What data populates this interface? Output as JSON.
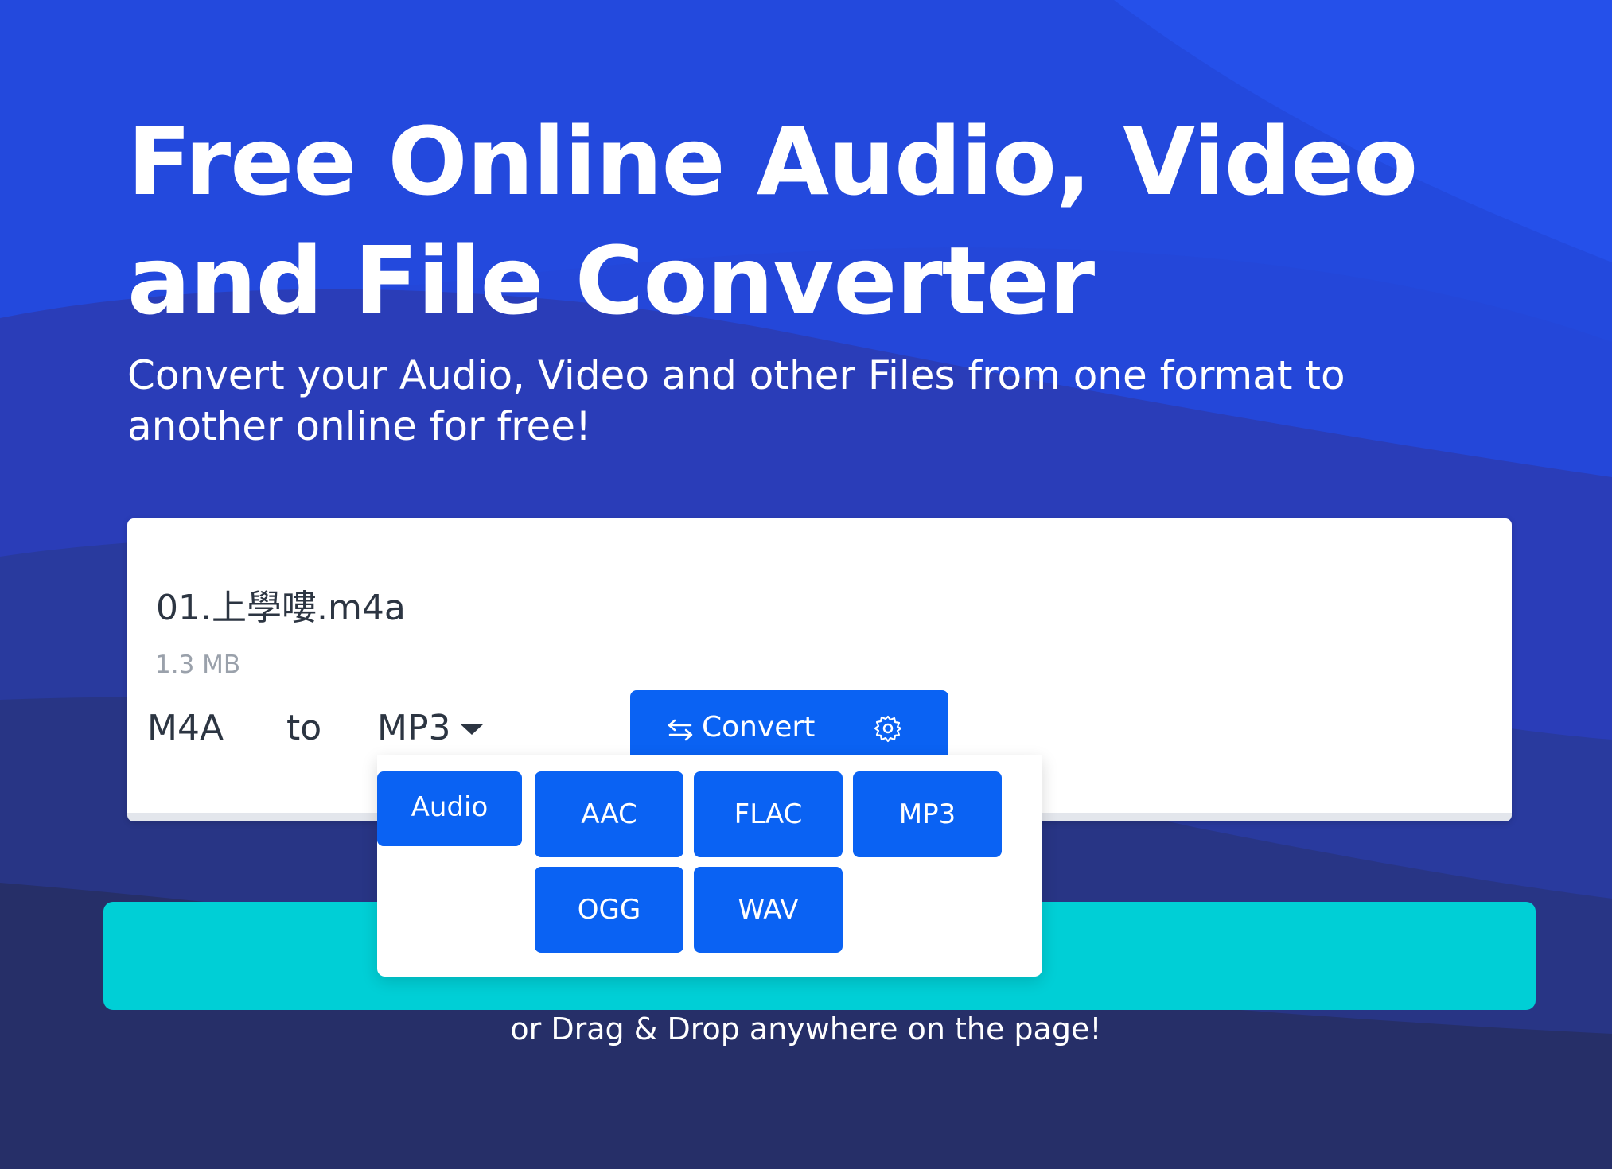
{
  "hero": {
    "title_line1": "Free Online Audio, Video",
    "title_line2": "and File Converter",
    "subtitle_line1": "Convert your Audio, Video and other Files from one format to",
    "subtitle_line2": "another online for free!"
  },
  "file": {
    "name": "01.上學嘍.m4a",
    "size": "1.3 MB",
    "from_format": "M4A",
    "to_label": "to",
    "target_format": "MP3"
  },
  "convert_button": {
    "label": "Convert",
    "icon": "swap-arrows-icon",
    "settings_icon": "gear-icon"
  },
  "dropdown": {
    "category": "Audio",
    "options": [
      "AAC",
      "FLAC",
      "MP3",
      "OGG",
      "WAV"
    ]
  },
  "drag_drop_hint": "or Drag & Drop anywhere on the page!",
  "colors": {
    "primary_button": "#0a62f3",
    "upload_bar": "#00cfd6",
    "background_top": "#2350e6",
    "background_bottom": "#252e5e"
  }
}
